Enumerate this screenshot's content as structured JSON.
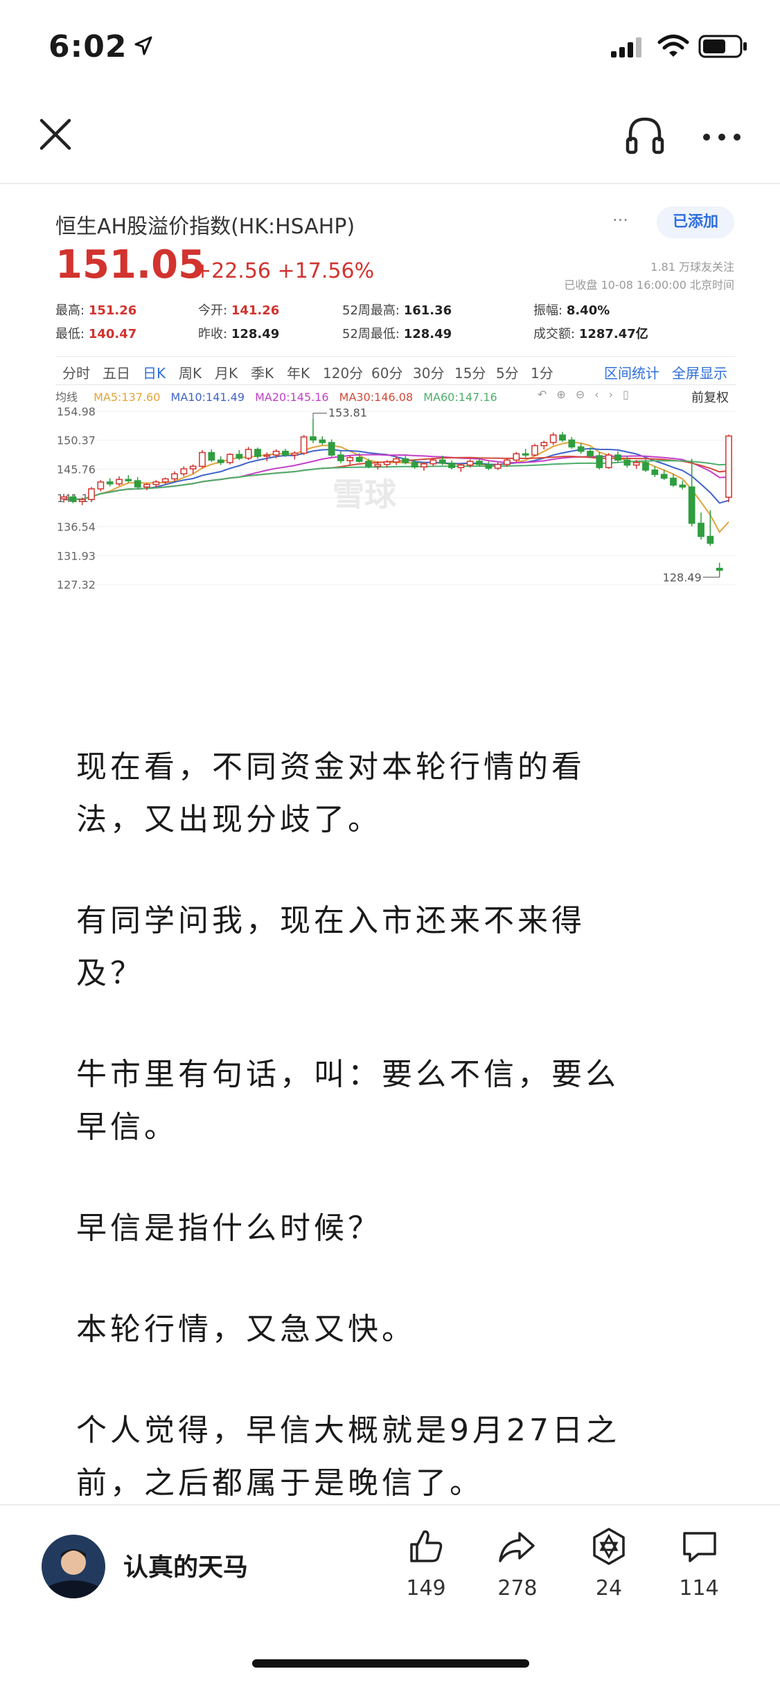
{
  "status": {
    "time": "6:02"
  },
  "stock": {
    "name": "恒生AH股溢价指数(HK:HSAHP)",
    "added_label": "已添加",
    "more": "···",
    "price": "151.05",
    "change": "+22.56 +17.56%",
    "fans": "1.81 万球友关注",
    "closed_info": "已收盘 10-08 16:00:00 北京时间",
    "stats": [
      {
        "label": "最高:",
        "value": "151.26"
      },
      {
        "label": "今开:",
        "value": "141.26"
      },
      {
        "label": "52周最高:",
        "value": "161.36"
      },
      {
        "label": "振幅:",
        "value": "8.40%"
      },
      {
        "label": "最低:",
        "value": "140.47"
      },
      {
        "label": "昨收:",
        "value": "128.49"
      },
      {
        "label": "52周最低:",
        "value": "128.49"
      },
      {
        "label": "成交额:",
        "value": "1287.47亿"
      }
    ],
    "tabs": [
      "分时",
      "五日",
      "日K",
      "周K",
      "月K",
      "季K",
      "年K",
      "120分",
      "60分",
      "30分",
      "15分",
      "5分",
      "1分"
    ],
    "active_tab": "日K",
    "tab_right": [
      "区间统计",
      "全屏显示"
    ],
    "ma_label": "均线",
    "ma": [
      {
        "name": "MA5:137.60",
        "color": "#e3a33a"
      },
      {
        "name": "MA10:141.49",
        "color": "#3f63c9"
      },
      {
        "name": "MA20:145.16",
        "color": "#c43ec9"
      },
      {
        "name": "MA30:146.08",
        "color": "#d24a3a"
      },
      {
        "name": "MA60:147.16",
        "color": "#4cae6a"
      }
    ],
    "fq_label": "前复权",
    "watermark": "雪球"
  },
  "chart_data": {
    "type": "candlestick",
    "ylim": [
      127.32,
      154.98
    ],
    "y_ticks": [
      "154.98",
      "150.37",
      "145.76",
      "141.17",
      "136.54",
      "131.93",
      "127.32"
    ],
    "annotations": [
      {
        "text": "153.81"
      },
      {
        "text": "128.49"
      }
    ],
    "candles": [
      [
        141.0,
        141.8,
        140.4,
        141.3
      ],
      [
        141.3,
        141.6,
        140.3,
        140.6
      ],
      [
        140.6,
        141.2,
        140.0,
        140.9
      ],
      [
        140.9,
        142.9,
        140.7,
        142.6
      ],
      [
        142.6,
        144.0,
        142.2,
        143.7
      ],
      [
        143.7,
        144.3,
        143.0,
        143.4
      ],
      [
        143.4,
        144.6,
        143.1,
        144.1
      ],
      [
        144.1,
        144.8,
        143.6,
        143.9
      ],
      [
        143.9,
        144.5,
        142.6,
        142.9
      ],
      [
        142.9,
        143.5,
        142.4,
        143.3
      ],
      [
        143.3,
        144.0,
        142.8,
        143.7
      ],
      [
        143.7,
        144.4,
        143.2,
        144.2
      ],
      [
        144.2,
        145.4,
        143.8,
        145.0
      ],
      [
        145.0,
        146.2,
        144.6,
        145.8
      ],
      [
        145.8,
        146.5,
        145.0,
        146.2
      ],
      [
        146.2,
        148.8,
        145.9,
        148.4
      ],
      [
        148.4,
        148.9,
        146.9,
        147.2
      ],
      [
        147.2,
        147.8,
        146.4,
        146.8
      ],
      [
        146.8,
        148.3,
        146.5,
        148.1
      ],
      [
        148.1,
        148.8,
        147.2,
        147.5
      ],
      [
        147.5,
        149.3,
        147.2,
        148.9
      ],
      [
        148.9,
        149.2,
        147.4,
        147.8
      ],
      [
        147.8,
        148.4,
        147.0,
        148.0
      ],
      [
        148.0,
        148.9,
        147.5,
        148.6
      ],
      [
        148.6,
        149.0,
        147.7,
        148.0
      ],
      [
        148.0,
        148.6,
        147.3,
        148.3
      ],
      [
        148.3,
        151.2,
        148.0,
        150.9
      ],
      [
        150.9,
        153.8,
        149.9,
        150.4
      ],
      [
        150.4,
        151.0,
        149.6,
        150.0
      ],
      [
        150.0,
        150.5,
        147.7,
        148.0
      ],
      [
        148.0,
        148.6,
        146.7,
        147.1
      ],
      [
        147.1,
        147.9,
        146.4,
        147.6
      ],
      [
        147.6,
        148.3,
        146.8,
        147.0
      ],
      [
        147.0,
        147.4,
        145.9,
        146.2
      ],
      [
        146.2,
        147.0,
        145.7,
        146.5
      ],
      [
        146.5,
        147.2,
        146.0,
        146.9
      ],
      [
        146.9,
        147.8,
        146.4,
        147.4
      ],
      [
        147.4,
        147.9,
        146.5,
        146.8
      ],
      [
        146.8,
        147.3,
        145.8,
        146.1
      ],
      [
        146.1,
        146.9,
        145.5,
        146.6
      ],
      [
        146.6,
        147.5,
        146.2,
        147.2
      ],
      [
        147.2,
        147.9,
        146.4,
        146.7
      ],
      [
        146.7,
        147.1,
        145.7,
        146.0
      ],
      [
        146.0,
        146.7,
        145.3,
        146.4
      ],
      [
        146.4,
        147.3,
        146.0,
        147.0
      ],
      [
        147.0,
        147.6,
        146.2,
        146.5
      ],
      [
        146.5,
        147.0,
        145.6,
        145.9
      ],
      [
        145.9,
        146.8,
        145.6,
        146.5
      ],
      [
        146.5,
        147.5,
        146.1,
        147.2
      ],
      [
        147.2,
        148.5,
        146.9,
        148.2
      ],
      [
        148.2,
        149.0,
        147.6,
        148.0
      ],
      [
        148.0,
        149.8,
        147.8,
        149.5
      ],
      [
        149.5,
        150.3,
        148.9,
        150.0
      ],
      [
        150.0,
        151.6,
        149.6,
        151.2
      ],
      [
        151.2,
        151.7,
        150.1,
        150.4
      ],
      [
        150.4,
        150.9,
        149.0,
        149.3
      ],
      [
        149.3,
        149.9,
        148.2,
        148.6
      ],
      [
        148.6,
        149.2,
        147.6,
        147.9
      ],
      [
        147.9,
        148.5,
        145.7,
        146.0
      ],
      [
        146.0,
        148.3,
        145.8,
        148.0
      ],
      [
        148.0,
        148.6,
        146.9,
        147.2
      ],
      [
        147.2,
        147.8,
        146.0,
        146.4
      ],
      [
        146.4,
        147.2,
        145.8,
        146.8
      ],
      [
        146.8,
        147.3,
        145.3,
        145.6
      ],
      [
        145.6,
        146.2,
        144.5,
        144.9
      ],
      [
        144.9,
        145.6,
        144.0,
        144.3
      ],
      [
        144.3,
        145.0,
        142.9,
        143.2
      ],
      [
        143.2,
        143.9,
        142.5,
        142.9
      ],
      [
        142.9,
        147.4,
        136.6,
        137.1
      ],
      [
        137.1,
        138.8,
        134.5,
        135.0
      ],
      [
        135.0,
        139.2,
        133.5,
        133.9
      ],
      [
        129.9,
        130.8,
        128.49,
        129.6
      ],
      [
        141.26,
        151.26,
        140.47,
        151.05
      ]
    ]
  },
  "article": {
    "paragraphs": [
      [
        "现在看，不同资金对本轮行情的看",
        "法，又出现分歧了。"
      ],
      [
        "有同学问我，现在入市还来不来得",
        "及？"
      ],
      [
        "牛市里有句话，叫：要么不信，要么",
        "早信。"
      ],
      [
        "早信是指什么时候？"
      ],
      [
        "本轮行情，又急又快。"
      ],
      [
        "个人觉得，早信大概就是9月27日之",
        "前，之后都属于是晚信了。"
      ]
    ]
  },
  "footer": {
    "author": "认真的天马",
    "like_count": "149",
    "share_count": "278",
    "reward_count": "24",
    "comment_count": "114"
  }
}
